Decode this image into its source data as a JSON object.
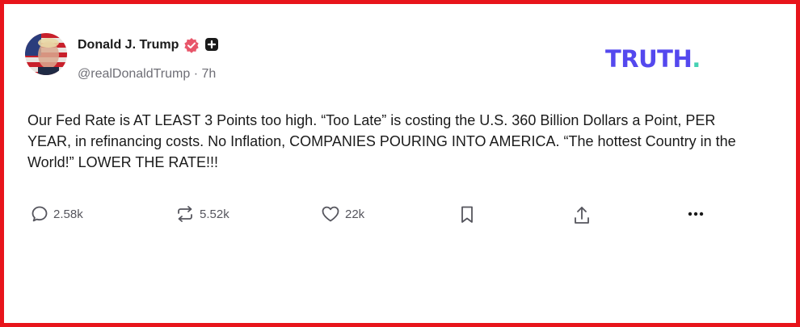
{
  "post": {
    "author_name": "Donald J. Trump",
    "handle": "@realDonaldTrump",
    "separator": "·",
    "time": "7h",
    "text": "Our Fed Rate is AT LEAST 3 Points too high. “Too Late” is costing the U.S. 360 Billion Dollars a Point, PER YEAR, in refinancing costs. No Inflation, COMPANIES POURING INTO AMERICA. “The hottest Country in the World!” LOWER THE RATE!!!"
  },
  "brand": {
    "name": "TRUTH",
    "dot": "."
  },
  "actions": {
    "replies": "2.58k",
    "retruths": "5.52k",
    "likes": "22k"
  },
  "icons": {
    "verified": "verified-badge-icon",
    "plus": "plus-badge-icon",
    "reply": "reply-bubble-icon",
    "retruth": "retruth-arrows-icon",
    "like": "heart-icon",
    "bookmark": "bookmark-icon",
    "share": "share-upload-icon",
    "more": "more-dots-icon"
  },
  "colors": {
    "frame": "#e8141b",
    "brand": "#5448ee",
    "brand_dot": "#45d1b3",
    "verified": "#e8566a"
  }
}
